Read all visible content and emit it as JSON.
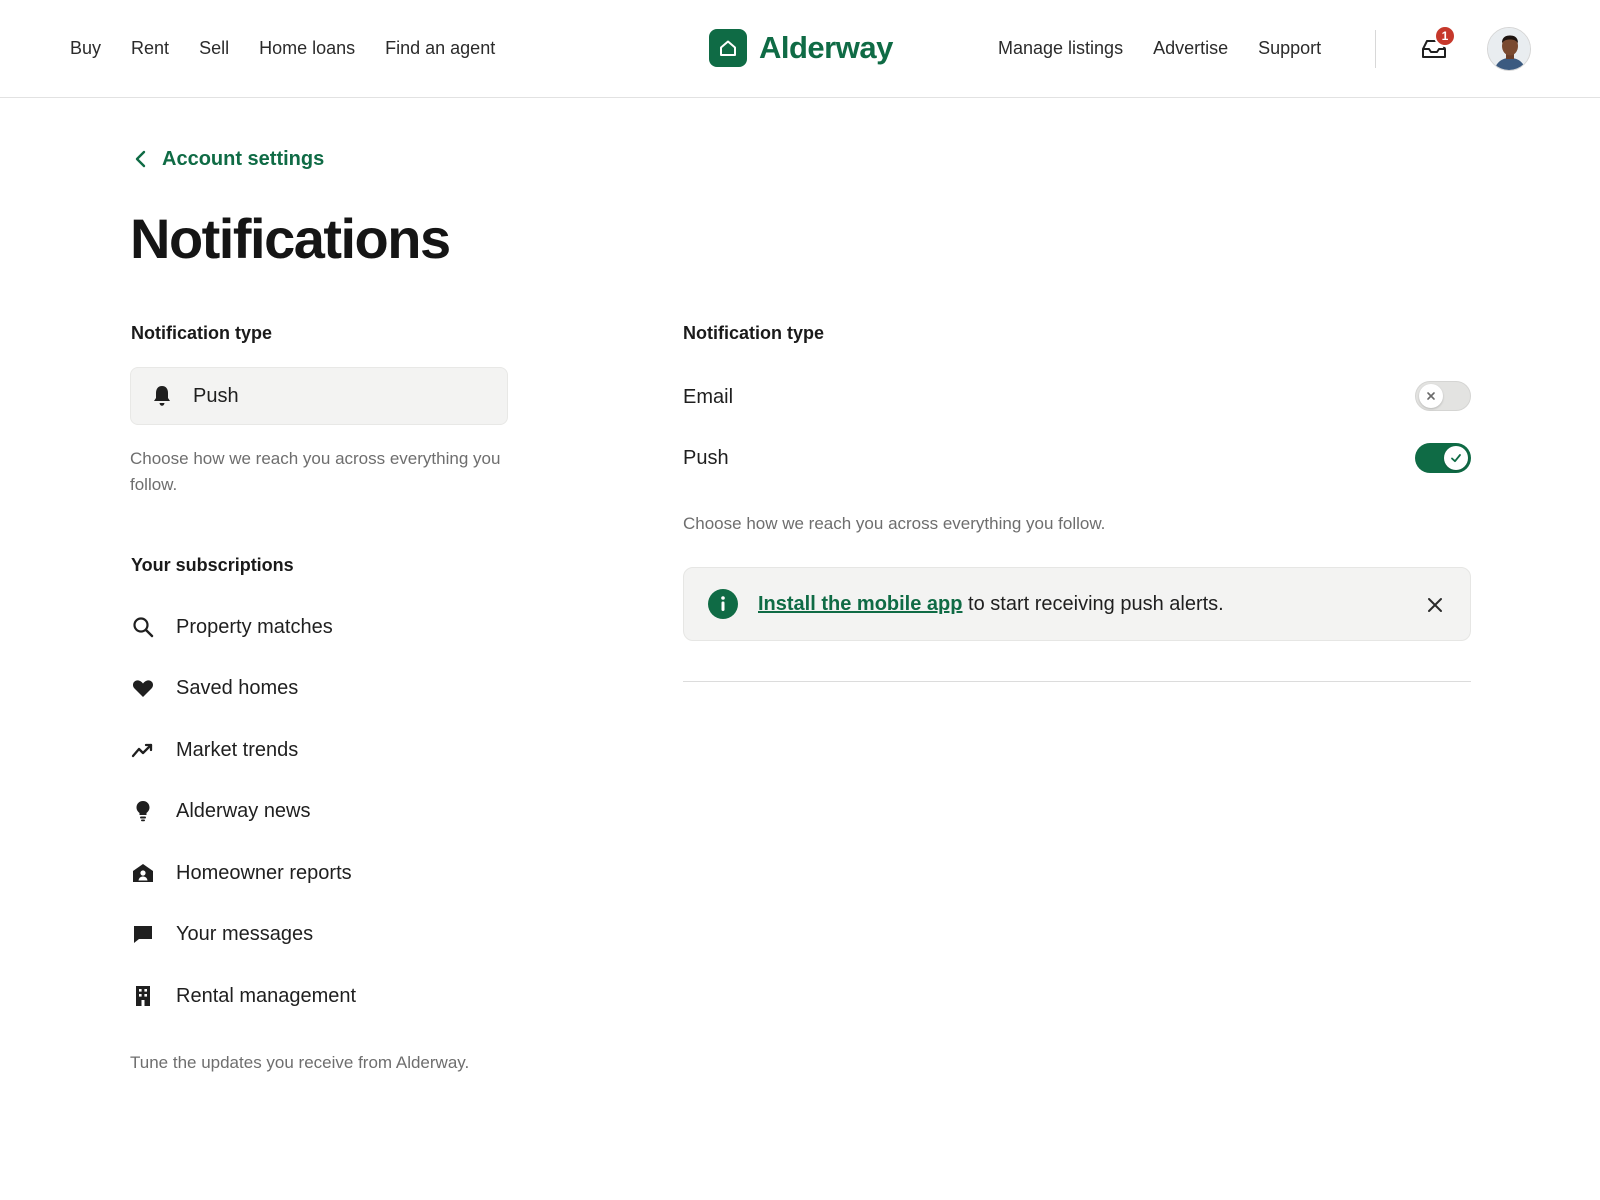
{
  "header": {
    "nav_left": [
      "Buy",
      "Rent",
      "Sell",
      "Home loans",
      "Find an agent"
    ],
    "brand": "Alderway",
    "nav_right": [
      "Manage listings",
      "Advertise",
      "Support"
    ],
    "notification_count": "1"
  },
  "breadcrumb": {
    "back_label": "Account settings"
  },
  "page_title": "Notifications",
  "left": {
    "section_title": "Notification type",
    "selected_type": "Push",
    "description": "Choose how we reach you across everything you follow.",
    "subscriptions_title": "Your subscriptions",
    "subscriptions": [
      {
        "label": "Property matches",
        "icon": "search-icon"
      },
      {
        "label": "Saved homes",
        "icon": "heart-icon"
      },
      {
        "label": "Market trends",
        "icon": "trend-icon"
      },
      {
        "label": "Alderway news",
        "icon": "lightbulb-icon"
      },
      {
        "label": "Homeowner reports",
        "icon": "house-person-icon"
      },
      {
        "label": "Your messages",
        "icon": "message-icon"
      },
      {
        "label": "Rental management",
        "icon": "building-icon"
      }
    ],
    "footer_note": "Tune the updates you receive from Alderway."
  },
  "right": {
    "section_title": "Notification type",
    "channels": [
      {
        "label": "Email",
        "enabled": false
      },
      {
        "label": "Push",
        "enabled": true
      }
    ],
    "description": "Choose how we reach you across everything you follow.",
    "banner": {
      "link_text": "Install the mobile app",
      "rest_text": " to start receiving push alerts."
    }
  },
  "colors": {
    "brand": "#0f6b45",
    "badge": "#c6382b"
  }
}
